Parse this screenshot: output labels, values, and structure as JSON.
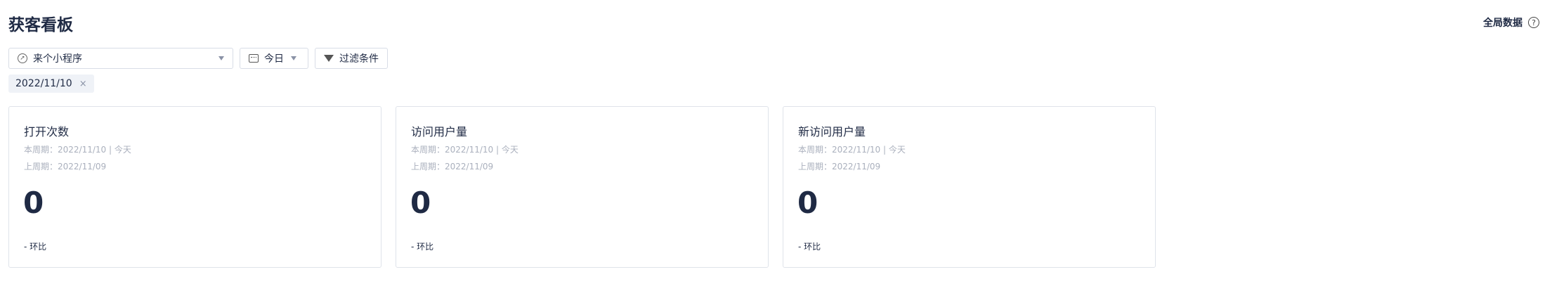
{
  "header": {
    "title": "获客看板",
    "global_label": "全局数据",
    "help_icon": "help-icon"
  },
  "toolbar": {
    "app_select": {
      "icon": "compass-icon",
      "value": "来个小程序"
    },
    "date_select": {
      "icon": "calendar-icon",
      "value": "今日"
    },
    "filter": {
      "icon": "funnel-icon",
      "label": "过滤条件"
    }
  },
  "date_tag": {
    "label": "2022/11/10",
    "close": "×"
  },
  "cards": [
    {
      "title": "打开次数",
      "current_period": "本周期：2022/11/10 | 今天",
      "previous_period": "上周期：2022/11/09",
      "value": "0",
      "ratio": "- 环比"
    },
    {
      "title": "访问用户量",
      "current_period": "本周期：2022/11/10 | 今天",
      "previous_period": "上周期：2022/11/09",
      "value": "0",
      "ratio": "- 环比"
    },
    {
      "title": "新访问用户量",
      "current_period": "本周期：2022/11/10 | 今天",
      "previous_period": "上周期：2022/11/09",
      "value": "0",
      "ratio": "- 环比"
    }
  ]
}
